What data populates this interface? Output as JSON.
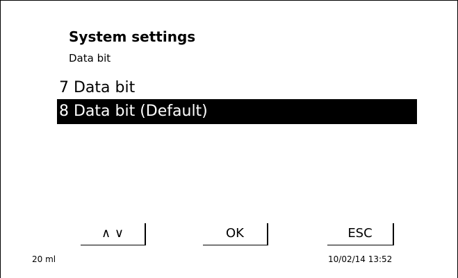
{
  "screen": {
    "title": "System settings",
    "subtitle": "Data bit"
  },
  "options": [
    {
      "label": "7 Data bit",
      "selected": false
    },
    {
      "label": "8 Data bit (Default)",
      "selected": true
    }
  ],
  "softkeys": {
    "navigate_label": "∧ ∨",
    "ok_label": "OK",
    "esc_label": "ESC"
  },
  "status": {
    "volume": "20 ml",
    "datetime": "10/02/14 13:52"
  }
}
